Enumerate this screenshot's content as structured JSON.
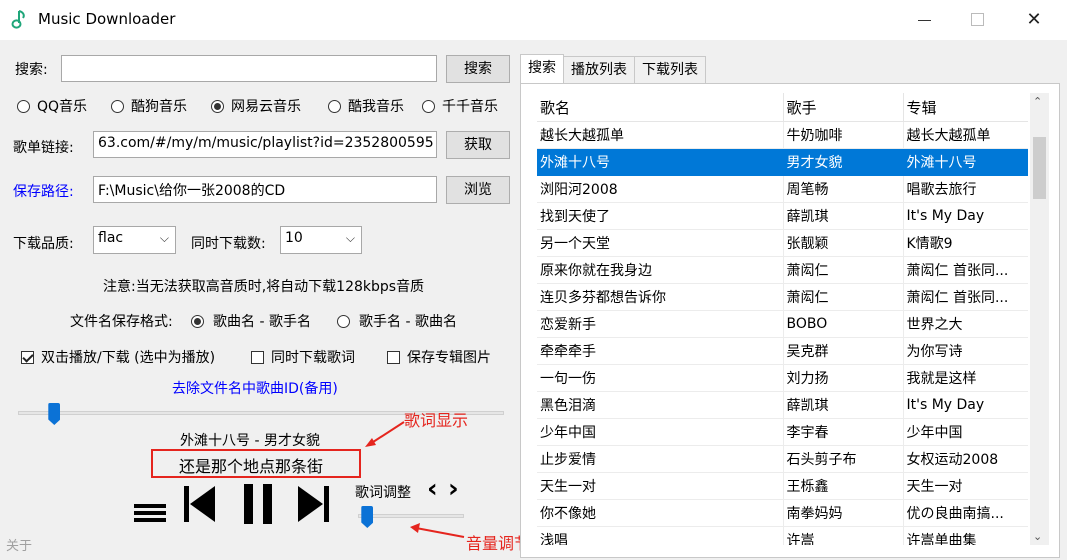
{
  "window": {
    "title": "Music Downloader",
    "close_glyph": "✕"
  },
  "search": {
    "label": "搜索:",
    "value": "",
    "button": "搜索"
  },
  "sources": [
    {
      "label": "QQ音乐",
      "selected": false
    },
    {
      "label": "酷狗音乐",
      "selected": false
    },
    {
      "label": "网易云音乐",
      "selected": true
    },
    {
      "label": "酷我音乐",
      "selected": false
    },
    {
      "label": "千千音乐",
      "selected": false
    }
  ],
  "playlist": {
    "label": "歌单链接:",
    "value": "63.com/#/my/m/music/playlist?id=2352800595",
    "button": "获取"
  },
  "save_path": {
    "label": "保存路径:",
    "value": "F:\\Music\\给你一张2008的CD",
    "button": "浏览",
    "label_color": "#0000ff"
  },
  "quality": {
    "label": "下载品质:",
    "value": "flac",
    "arrow": "⌵"
  },
  "concurrency": {
    "label": "同时下载数:",
    "value": "10",
    "arrow": "⌵"
  },
  "notice": "注意:当无法获取高音质时,将自动下载128kbps音质",
  "filename_format": {
    "label": "文件名保存格式:",
    "options": [
      {
        "label": "歌曲名 - 歌手名",
        "selected": true
      },
      {
        "label": "歌手名 - 歌曲名",
        "selected": false
      }
    ]
  },
  "checkboxes": [
    {
      "label": "双击播放/下载 (选中为播放)",
      "checked": true
    },
    {
      "label": "同时下载歌词",
      "checked": false
    },
    {
      "label": "保存专辑图片",
      "checked": false
    }
  ],
  "remove_id_link": "去除文件名中歌曲ID(备用)",
  "progress": {
    "fraction": 0.05
  },
  "now_playing": {
    "title": "外滩十八号 - 男才女貌",
    "lyric": "还是那个地点那条街"
  },
  "lyric_adjust": {
    "label": "歌词调整",
    "prev": "‹",
    "next": "›"
  },
  "volume": {
    "fraction": 0.05
  },
  "annotations": {
    "lyrics_display": "歌词显示",
    "volume_adjust": "音量调节"
  },
  "about": "关于",
  "tabs": [
    {
      "label": "搜索",
      "active": true
    },
    {
      "label": "播放列表",
      "active": false
    },
    {
      "label": "下载列表",
      "active": false
    }
  ],
  "columns": [
    "歌名",
    "歌手",
    "专辑"
  ],
  "rows": [
    [
      "越长大越孤单",
      "牛奶咖啡",
      "越长大越孤单"
    ],
    [
      "外滩十八号",
      "男才女貌",
      "外滩十八号"
    ],
    [
      "浏阳河2008",
      "周笔畅",
      "唱歌去旅行"
    ],
    [
      "找到天使了",
      "薛凯琪",
      "It's My Day"
    ],
    [
      "另一个天堂",
      "张靓颖",
      "K情歌9"
    ],
    [
      "原来你就在我身边",
      "萧闳仁",
      "萧闳仁 首张同..."
    ],
    [
      "连贝多芬都想告诉你",
      "萧闳仁",
      "萧闳仁 首张同..."
    ],
    [
      "恋爱新手",
      "BOBO",
      "世界之大"
    ],
    [
      "牵牵牵手",
      "吴克群",
      "为你写诗"
    ],
    [
      "一句一伤",
      "刘力扬",
      "我就是这样"
    ],
    [
      "黑色泪滴",
      "薛凯琪",
      "It's My Day"
    ],
    [
      "少年中国",
      "李宇春",
      "少年中国"
    ],
    [
      "止步爱情",
      "石头剪子布",
      "女权运动2008"
    ],
    [
      "天生一对",
      "王栎鑫",
      "天生一对"
    ],
    [
      "你不像她",
      "南拳妈妈",
      "优の良曲南搞..."
    ],
    [
      "浅唱",
      "许嵩",
      "许嵩单曲集"
    ]
  ],
  "selected_row": 1,
  "accent_color": "#0078d7",
  "annotation_color": "#e5251e"
}
